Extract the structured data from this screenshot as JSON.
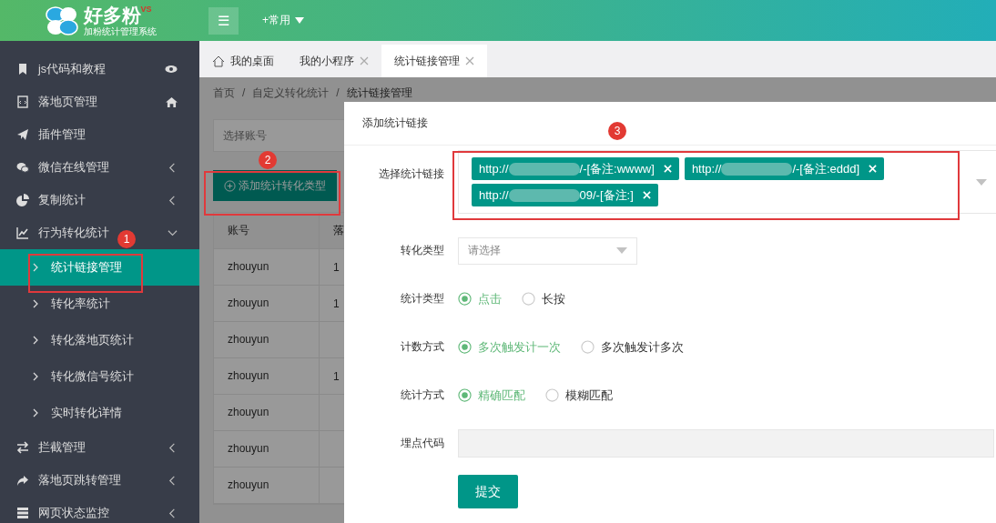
{
  "header": {
    "logo_text": "好多粉",
    "logo_badge": "VS",
    "logo_subtitle": "加粉统计管理系统",
    "menu_toggle": "☰",
    "shortcut": "+常用"
  },
  "sidebar": {
    "items": [
      {
        "label": "js代码和教程"
      },
      {
        "label": "落地页管理"
      },
      {
        "label": "插件管理"
      },
      {
        "label": "微信在线管理",
        "expanded": false
      },
      {
        "label": "复制统计",
        "expanded": false
      },
      {
        "label": "行为转化统计",
        "expanded": true,
        "children": [
          {
            "label": "统计链接管理",
            "selected": true
          },
          {
            "label": "转化率统计",
            "selected": false
          },
          {
            "label": "转化落地页统计",
            "selected": false
          },
          {
            "label": "转化微信号统计",
            "selected": false
          },
          {
            "label": "实时转化详情",
            "selected": false
          }
        ]
      },
      {
        "label": "拦截管理",
        "expanded": false
      },
      {
        "label": "落地页跳转管理",
        "expanded": false
      },
      {
        "label": "网页状态监控",
        "expanded": false
      }
    ]
  },
  "tabs": [
    {
      "label": "我的桌面",
      "home": true,
      "closable": false,
      "selected": false
    },
    {
      "label": "我的小程序",
      "home": false,
      "closable": true,
      "selected": false
    },
    {
      "label": "统计链接管理",
      "home": false,
      "closable": true,
      "selected": true
    }
  ],
  "breadcrumb": [
    {
      "kind": "link",
      "text": "首页"
    },
    {
      "kind": "separator",
      "text": "/"
    },
    {
      "kind": "link",
      "text": "自定义转化统计"
    },
    {
      "kind": "separator",
      "text": "/"
    },
    {
      "kind": "current",
      "text": "统计链接管理"
    }
  ],
  "account_select": {
    "placeholder": "选择账号"
  },
  "add_button": "添加统计转化类型",
  "table": {
    "columns": [
      "账号",
      "落"
    ],
    "rows": [
      {
        "account": "zhouyun",
        "column_2": "1"
      },
      {
        "account": "zhouyun",
        "column_2": "1"
      },
      {
        "account": "zhouyun"
      },
      {
        "account": "zhouyun",
        "column_2": "1"
      },
      {
        "account": "zhouyun"
      },
      {
        "account": "zhouyun"
      },
      {
        "account": "zhouyun"
      }
    ]
  },
  "dialog": {
    "title": "添加统计链接",
    "link_field": {
      "label": "选择统计链接",
      "tags": [
        {
          "prefix": "http://",
          "suffix": "/-[备注:wwww]"
        },
        {
          "prefix": "http://",
          "suffix": "/-[备注:eddd]"
        },
        {
          "prefix": "http://",
          "suffix": "09/-[备注:]"
        }
      ]
    },
    "type_field": {
      "label": "转化类型",
      "placeholder": "请选择"
    },
    "radio_groups": [
      {
        "label": "统计类型",
        "options": [
          {
            "label": "点击",
            "selected": true
          },
          {
            "label": "长按",
            "selected": false
          }
        ]
      },
      {
        "label": "计数方式",
        "options": [
          {
            "label": "多次触发计一次",
            "selected": true
          },
          {
            "label": "多次触发计多次",
            "selected": false
          }
        ]
      },
      {
        "label": "统计方式",
        "options": [
          {
            "label": "精确匹配",
            "selected": true
          },
          {
            "label": "模糊匹配",
            "selected": false
          }
        ]
      }
    ],
    "code_field": {
      "label": "埋点代码"
    },
    "submit": "提交"
  },
  "annotations": [
    {
      "number": "1"
    },
    {
      "number": "2"
    },
    {
      "number": "3"
    }
  ]
}
